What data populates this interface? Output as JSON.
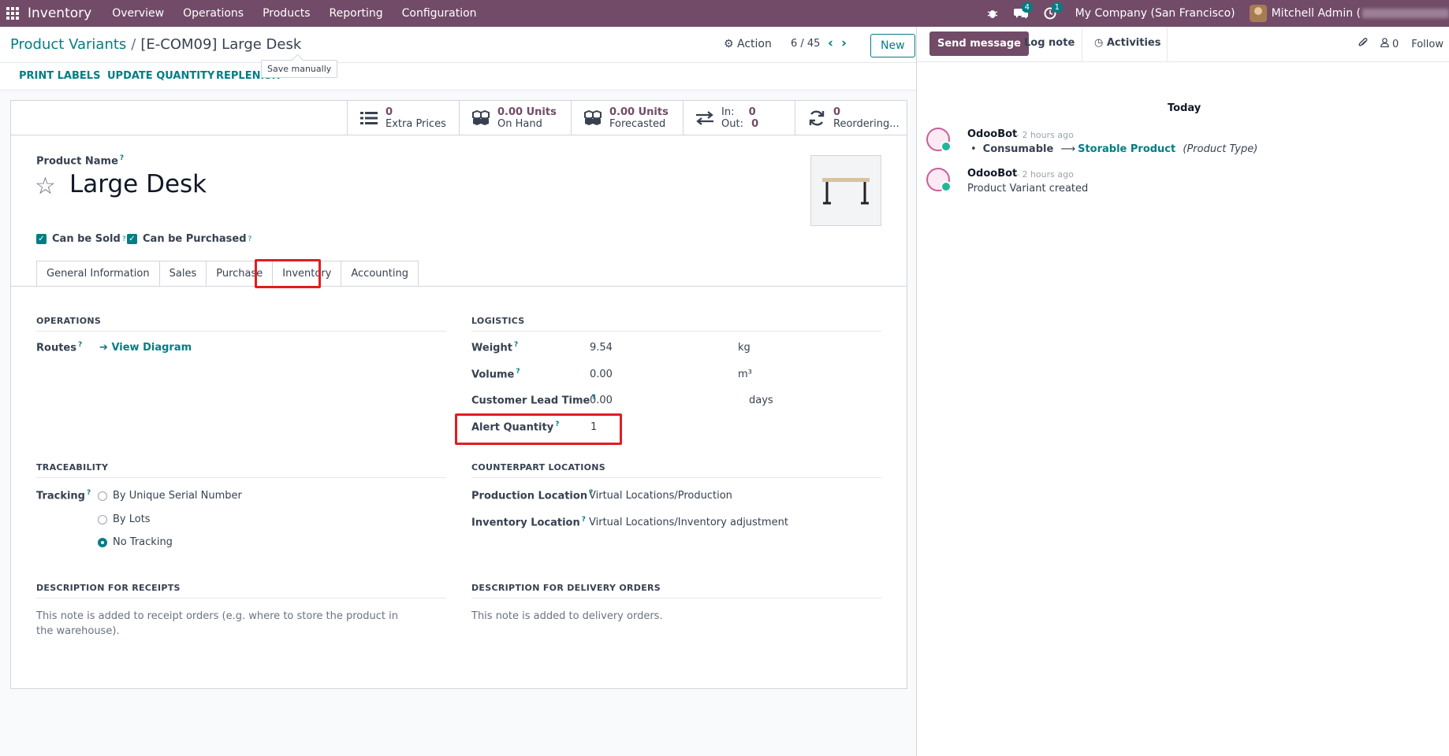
{
  "navbar": {
    "app_name": "Inventory",
    "menu": [
      "Overview",
      "Operations",
      "Products",
      "Reporting",
      "Configuration"
    ],
    "messages_badge": "4",
    "activities_badge": "1",
    "company": "My Company (San Francisco)",
    "user": "Mitchell Admin ("
  },
  "breadcrumb": {
    "parent": "Product Variants",
    "separator": "/",
    "current": "[E-COM09] Large Desk"
  },
  "control": {
    "action_label": "Action",
    "pager": "6 / 45",
    "new_label": "New",
    "tooltip": "Save manually"
  },
  "statusbar": {
    "buttons": [
      "PRINT LABELS",
      "UPDATE QUANTITY",
      "REPLENISH"
    ]
  },
  "smart_buttons": [
    {
      "icon": "list-icon",
      "value": "0",
      "label": "Extra Prices"
    },
    {
      "icon": "cubes-icon",
      "value": "0.00 Units",
      "label": "On Hand"
    },
    {
      "icon": "cubes-icon",
      "value": "0.00 Units",
      "label": "Forecasted"
    },
    {
      "icon": "transfer-icon",
      "in_label": "In:",
      "in_value": "0",
      "out_label": "Out:",
      "out_value": "0"
    },
    {
      "icon": "refresh-icon",
      "value": "0",
      "label": "Reordering..."
    }
  ],
  "product": {
    "name_label": "Product Name",
    "name": "Large Desk",
    "can_be_sold": "Can be Sold",
    "can_be_purchased": "Can be Purchased"
  },
  "tabs": [
    "General Information",
    "Sales",
    "Purchase",
    "Inventory",
    "Accounting"
  ],
  "active_tab": "Inventory",
  "operations": {
    "title": "OPERATIONS",
    "routes_label": "Routes",
    "view_diagram": "View Diagram"
  },
  "logistics": {
    "title": "LOGISTICS",
    "weight_label": "Weight",
    "weight_value": "9.54",
    "weight_unit": "kg",
    "volume_label": "Volume",
    "volume_value": "0.00",
    "volume_unit": "m³",
    "lead_label": "Customer Lead Time",
    "lead_value": "0.00",
    "lead_unit": "days",
    "alert_label": "Alert Quantity",
    "alert_value": "1"
  },
  "traceability": {
    "title": "TRACEABILITY",
    "tracking_label": "Tracking",
    "options": [
      "By Unique Serial Number",
      "By Lots",
      "No Tracking"
    ],
    "selected": "No Tracking"
  },
  "counterpart": {
    "title": "COUNTERPART LOCATIONS",
    "production_label": "Production Location",
    "production_value": "Virtual Locations/Production",
    "inventory_label": "Inventory Location",
    "inventory_value": "Virtual Locations/Inventory adjustment"
  },
  "desc_receipts": {
    "title": "DESCRIPTION FOR RECEIPTS",
    "placeholder": "This note is added to receipt orders (e.g. where to store the product in the warehouse)."
  },
  "desc_delivery": {
    "title": "DESCRIPTION FOR DELIVERY ORDERS",
    "placeholder": "This note is added to delivery orders."
  },
  "chatter": {
    "send_message": "Send message",
    "log_note": "Log note",
    "activities": "Activities",
    "followers_count": "0",
    "follow": "Follow",
    "date_separator": "Today",
    "messages": [
      {
        "author": "OdooBot",
        "ago": "- 2 hours ago",
        "old_value": "Consumable",
        "new_value": "Storable Product",
        "field": "(Product Type)"
      },
      {
        "author": "OdooBot",
        "ago": "- 2 hours ago",
        "body": "Product Variant created"
      }
    ]
  },
  "colors": {
    "brand": "#714b67",
    "accent": "#017e84",
    "highlight": "#e11d21"
  }
}
